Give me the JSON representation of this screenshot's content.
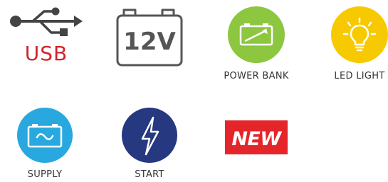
{
  "features": [
    {
      "id": "usb",
      "label": "USB",
      "icon": "usb-icon",
      "color": "#d2232a"
    },
    {
      "id": "12v",
      "label": "12V",
      "icon": "battery-12v-icon",
      "color": "#555555"
    },
    {
      "id": "power-bank",
      "label": "POWER BANK",
      "icon": "battery-charge-icon",
      "color": "#8dc63f"
    },
    {
      "id": "led-light",
      "label": "LED LIGHT",
      "icon": "light-bulb-icon",
      "color": "#f7c900"
    },
    {
      "id": "supply",
      "label": "SUPPLY",
      "icon": "battery-wave-icon",
      "color": "#29a8e0"
    },
    {
      "id": "start",
      "label": "START",
      "icon": "lightning-bolt-icon",
      "color": "#253880"
    },
    {
      "id": "new",
      "label": "NEW",
      "icon": "new-badge",
      "color": "#e4262b"
    }
  ]
}
